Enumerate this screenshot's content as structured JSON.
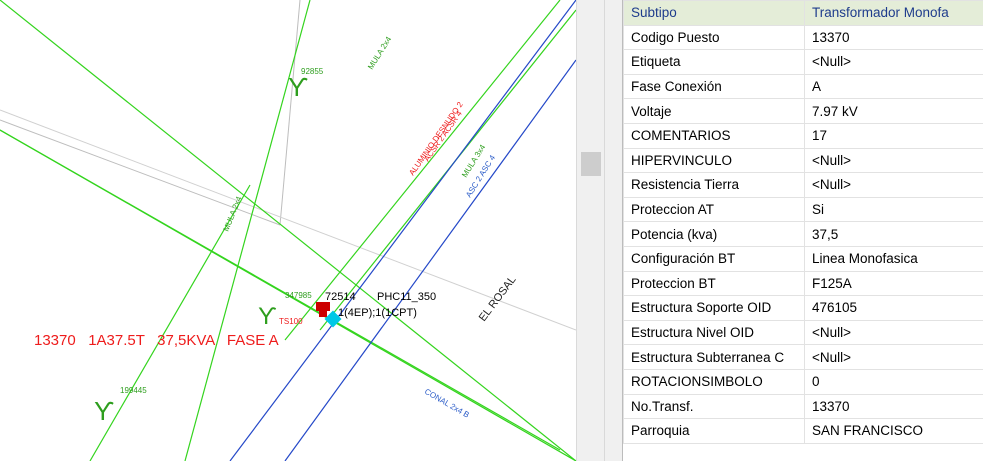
{
  "map": {
    "labels": {
      "pole_92855": "92855",
      "pole_199445": "199445",
      "pole_347985": "347985",
      "pole_ts": "TS100",
      "symbol_char": "ϒ",
      "mula_1": "MULA 2x4",
      "mula_2": "MULA 2x4",
      "mula_3": "MULA 3x4",
      "asc_1": "ASC 2 ASC 4",
      "asc_2": "ASC 2 ASC 4",
      "aluminio_1": "ALUMINIO DESNUDO 2",
      "aluminio_2": "ACSR 2 ACSR 4",
      "el_rosal": "EL ROSAL",
      "conal": "CONAL 2x4 B",
      "transformer_id": "72514",
      "transformer_phc": "PHC11_350",
      "transformer_detail": "1(4EP);1(1CPT)",
      "transformer_caption": "13370   1A37.5T   37,5KVA   FASE A"
    },
    "colors": {
      "green_line": "#34d41e",
      "blue_line": "#2448c8",
      "gray_line": "#bdbdbd",
      "red_text": "#ee1c1c",
      "blue_text": "#2b5cc8",
      "transformer_red": "#cc0000",
      "transformer_cyan": "#00c8e6"
    }
  },
  "attributes": {
    "rows": [
      {
        "field": "Subtipo",
        "value": "Transformador Monofa"
      },
      {
        "field": "Codigo Puesto",
        "value": "13370"
      },
      {
        "field": "Etiqueta",
        "value": "<Null>"
      },
      {
        "field": "Fase Conexión",
        "value": "A"
      },
      {
        "field": "Voltaje",
        "value": "7.97 kV"
      },
      {
        "field": "COMENTARIOS",
        "value": "17"
      },
      {
        "field": "HIPERVINCULO",
        "value": "<Null>"
      },
      {
        "field": "Resistencia Tierra",
        "value": "<Null>"
      },
      {
        "field": "Proteccion AT",
        "value": "Si"
      },
      {
        "field": "Potencia (kva)",
        "value": "37,5"
      },
      {
        "field": "Configuración BT",
        "value": "Linea Monofasica"
      },
      {
        "field": "Proteccion BT",
        "value": "F125A"
      },
      {
        "field": "Estructura Soporte OID",
        "value": "476105"
      },
      {
        "field": "Estructura Nivel OID",
        "value": "<Null>"
      },
      {
        "field": "Estructura Subterranea C",
        "value": "<Null>"
      },
      {
        "field": "ROTACIONSIMBOLO",
        "value": "0"
      },
      {
        "field": "No.Transf.",
        "value": "13370"
      },
      {
        "field": "Parroquia",
        "value": "SAN FRANCISCO"
      }
    ],
    "header_bg": "#e4edd8",
    "header_text_color": "#1e3c8c"
  }
}
